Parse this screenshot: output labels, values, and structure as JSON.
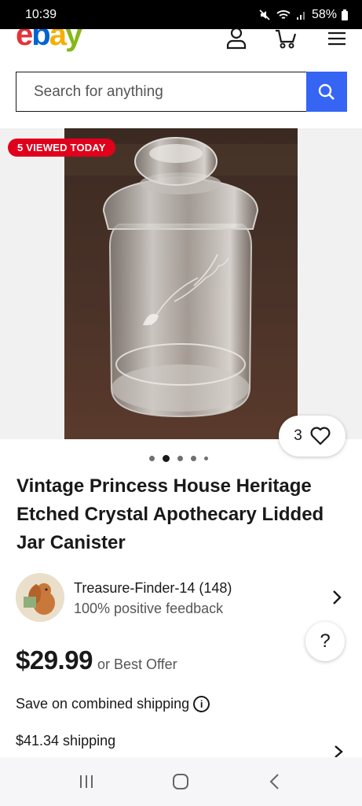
{
  "status_bar": {
    "time": "10:39",
    "battery": "58%"
  },
  "header": {
    "logo": {
      "e": "e",
      "b": "b",
      "a": "a",
      "y": "y"
    },
    "icons": [
      "user-icon",
      "cart-icon",
      "menu-icon"
    ]
  },
  "search": {
    "placeholder": "Search for anything",
    "icon": "search-icon"
  },
  "gallery": {
    "badge": "5 VIEWED TODAY",
    "watch_count": "3",
    "page_dots": 5,
    "active_dot": 2
  },
  "listing": {
    "title": "Vintage Princess House Heritage Etched Crystal Apothecary Lidded Jar Canister",
    "price": "$29.99",
    "best_offer": "or Best Offer",
    "combined_shipping": "Save on combined shipping",
    "shipping_cost": "$41.34 shipping"
  },
  "seller": {
    "name": "Treasure-Finder-14 (148)",
    "feedback": "100% positive feedback"
  },
  "help": {
    "label": "?"
  },
  "colors": {
    "accent": "#3665f3",
    "badge": "#e0001b",
    "text": "#191919",
    "muted": "#555555"
  }
}
